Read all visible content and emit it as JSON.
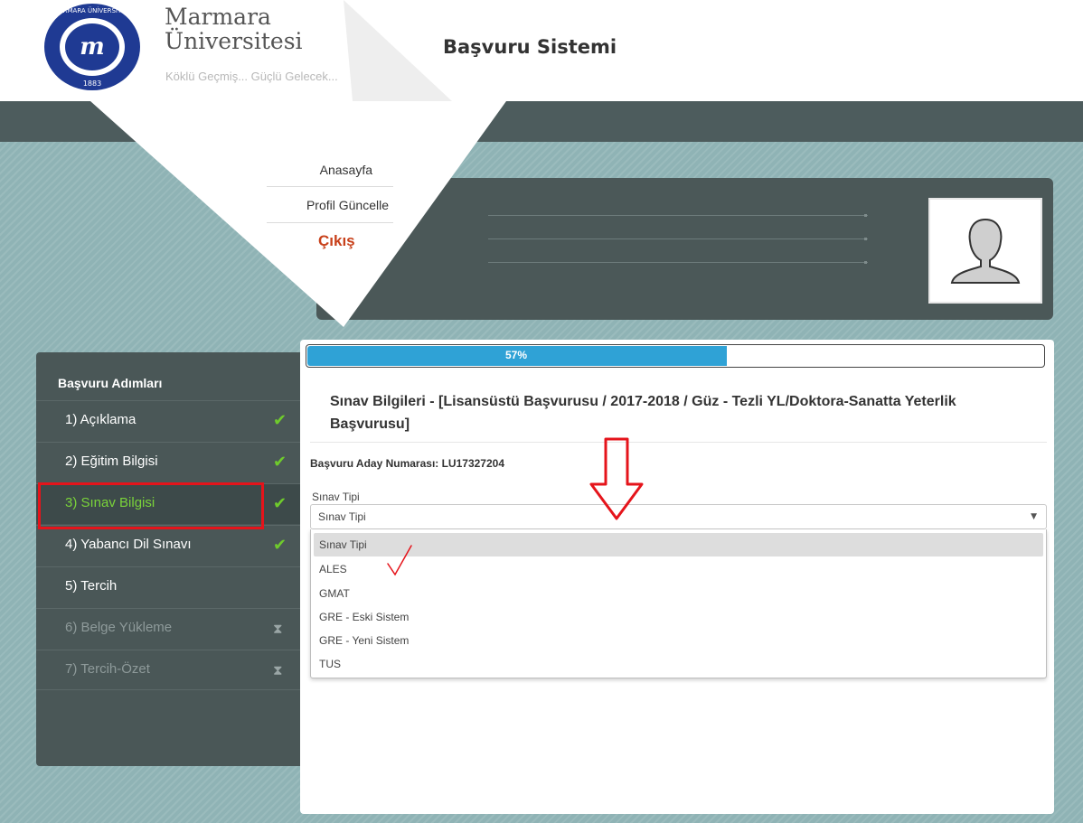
{
  "header": {
    "brand_line1": "Marmara",
    "brand_line2": "Üniversitesi",
    "slogan": "Köklü Geçmiş... Güçlü Gelecek...",
    "system_title": "Başvuru Sistemi",
    "seal": {
      "text": "MARMARA ÜNİVERSİTESİ",
      "year": "1883",
      "mark": "m"
    },
    "colors": {
      "seal_blue": "#1f3a93"
    }
  },
  "nav": {
    "home": "Anasayfa",
    "profile_update": "Profil Güncelle",
    "logout": "Çıkış",
    "colors": {
      "logout": "#c8411b"
    }
  },
  "profile": {
    "avatar_icon": "user-silhouette-icon"
  },
  "sidebar": {
    "title": "Başvuru Adımları",
    "steps": [
      {
        "label": "1) Açıklama",
        "status": "done",
        "icon": "check-icon"
      },
      {
        "label": "2) Eğitim Bilgisi",
        "status": "done",
        "icon": "check-icon"
      },
      {
        "label": "3) Sınav Bilgisi",
        "status": "done",
        "icon": "check-icon",
        "active": true
      },
      {
        "label": "4) Yabancı Dil Sınavı",
        "status": "done",
        "icon": "check-icon"
      },
      {
        "label": "5) Tercih",
        "status": "pending"
      },
      {
        "label": "6) Belge Yükleme",
        "status": "locked",
        "icon": "hourglass-icon"
      },
      {
        "label": "7) Tercih-Özet",
        "status": "locked",
        "icon": "hourglass-icon"
      }
    ],
    "colors": {
      "active_text": "#7ad33a",
      "check": "#6fcb2c",
      "highlight_border": "#e5141b"
    }
  },
  "main": {
    "progress": {
      "value": 0.57,
      "label": "57%",
      "color": "#2fa2d6"
    },
    "title": "Sınav Bilgileri - [Lisansüstü Başvurusu / 2017-2018 / Güz - Tezli YL/Doktora-Sanatta Yeterlik Başvurusu]",
    "candidate_number": "Başvuru Aday Numarası: LU17327204",
    "exam_type": {
      "label": "Sınav Tipi",
      "selected": "Sınav Tipi",
      "options": [
        "Sınav Tipi",
        "ALES",
        "GMAT",
        "GRE - Eski Sistem",
        "GRE - Yeni Sistem",
        "TUS"
      ],
      "hovered_index": 0
    },
    "annotations": {
      "arrow": "down-arrow-annotation",
      "tick": "checkmark-annotation",
      "color": "#e5141b"
    }
  }
}
